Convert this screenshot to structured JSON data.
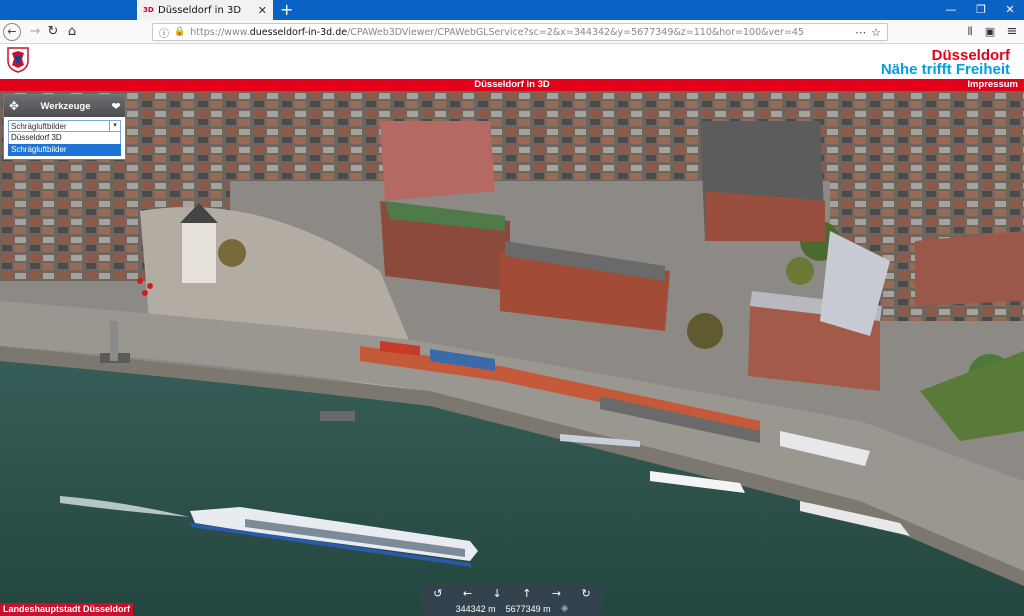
{
  "browser": {
    "tab": {
      "title": "Düsseldorf in 3D",
      "icon": "3D"
    },
    "url_prefix": "https://www.",
    "url_host": "duesseldorf-in-3d.de",
    "url_path": "/CPAWeb3DViewer/CPAWebGLService?sc=2&x=344342&y=5677349&z=110&hor=100&ver=45"
  },
  "site": {
    "brand_line1": "Düsseldorf",
    "brand_line2": "Nähe trifft Freiheit",
    "banner_title": "Düsseldorf in 3D",
    "impressum": "Impressum",
    "footer_label": "Landeshauptstadt Düsseldorf"
  },
  "tools": {
    "title": "Werkzeuge",
    "selected": "Schrägluftbilder",
    "options": [
      "Düsseldorf 3D",
      "Schrägluftbilder"
    ]
  },
  "coords": {
    "x": "344342 m",
    "y": "5677349 m"
  },
  "colors": {
    "brand_red": "#e2001a",
    "brand_blue": "#00a0e3",
    "tab_blue": "#0b62c5"
  }
}
